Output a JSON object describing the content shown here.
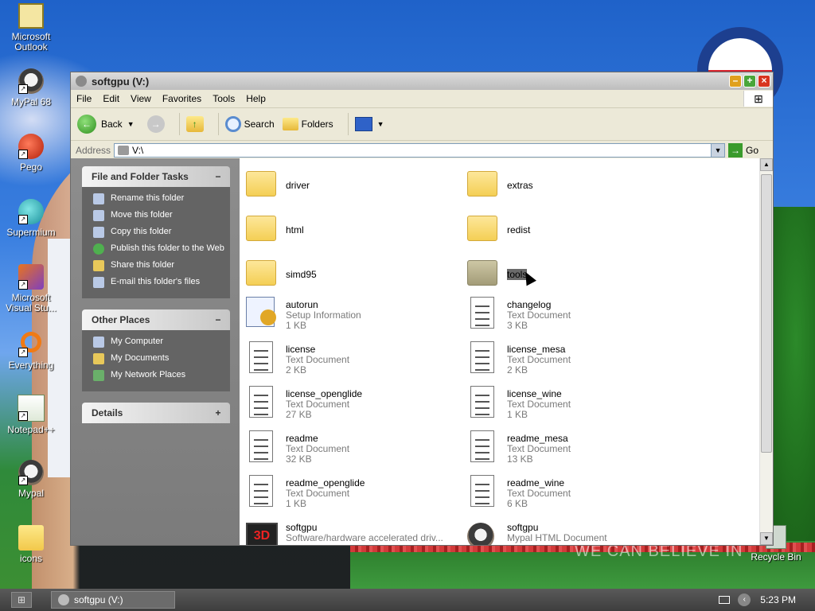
{
  "desktop": {
    "icons": [
      {
        "label": "Microsoft Outlook",
        "icon": "outlook-icon"
      },
      {
        "label": "MyPal 68",
        "icon": "raccoon-icon"
      },
      {
        "label": "Pego",
        "icon": "pego-icon"
      },
      {
        "label": "Supermium",
        "icon": "supermium-icon"
      },
      {
        "label": "Microsoft Visual Stu...",
        "icon": "visual-studio-icon"
      },
      {
        "label": "Everything",
        "icon": "everything-icon"
      },
      {
        "label": "Notepad++",
        "icon": "notepad-icon"
      },
      {
        "label": "Mypal",
        "icon": "raccoon-icon"
      },
      {
        "label": "icons",
        "icon": "folder-icon"
      },
      {
        "label": "Recycle Bin",
        "icon": "recycle-bin-icon"
      }
    ],
    "wallpaper_text": "WE CAN BELIEVE IN"
  },
  "window": {
    "title": "softgpu (V:)",
    "menu": [
      "File",
      "Edit",
      "View",
      "Favorites",
      "Tools",
      "Help"
    ],
    "toolbar": {
      "back": "Back",
      "search": "Search",
      "folders": "Folders"
    },
    "address": {
      "label": "Address",
      "value": "V:\\",
      "go": "Go"
    },
    "tasks_panel": {
      "title": "File and Folder Tasks",
      "items": [
        "Rename this folder",
        "Move this folder",
        "Copy this folder",
        "Publish this folder to the Web",
        "Share this folder",
        "E-mail this folder's files"
      ]
    },
    "places_panel": {
      "title": "Other Places",
      "items": [
        "My Computer",
        "My Documents",
        "My Network Places"
      ]
    },
    "details_panel": {
      "title": "Details"
    },
    "files": [
      {
        "name": "driver",
        "kind": "folder"
      },
      {
        "name": "extras",
        "kind": "folder"
      },
      {
        "name": "html",
        "kind": "folder"
      },
      {
        "name": "redist",
        "kind": "folder"
      },
      {
        "name": "simd95",
        "kind": "folder"
      },
      {
        "name": "tools",
        "kind": "folder",
        "selected": true
      },
      {
        "name": "autorun",
        "type": "Setup Information",
        "size": "1 KB",
        "kind": "setup"
      },
      {
        "name": "changelog",
        "type": "Text Document",
        "size": "3 KB",
        "kind": "text"
      },
      {
        "name": "license",
        "type": "Text Document",
        "size": "2 KB",
        "kind": "text"
      },
      {
        "name": "license_mesa",
        "type": "Text Document",
        "size": "2 KB",
        "kind": "text"
      },
      {
        "name": "license_openglide",
        "type": "Text Document",
        "size": "27 KB",
        "kind": "text"
      },
      {
        "name": "license_wine",
        "type": "Text Document",
        "size": "1 KB",
        "kind": "text"
      },
      {
        "name": "readme",
        "type": "Text Document",
        "size": "32 KB",
        "kind": "text"
      },
      {
        "name": "readme_mesa",
        "type": "Text Document",
        "size": "13 KB",
        "kind": "text"
      },
      {
        "name": "readme_openglide",
        "type": "Text Document",
        "size": "1 KB",
        "kind": "text"
      },
      {
        "name": "readme_wine",
        "type": "Text Document",
        "size": "6 KB",
        "kind": "text"
      },
      {
        "name": "softgpu",
        "type": "Software/hardware accelerated driv...",
        "size": "",
        "kind": "3d"
      },
      {
        "name": "softgpu",
        "type": "Mypal HTML Document",
        "size": "",
        "kind": "html"
      }
    ]
  },
  "taskbar": {
    "button": "softgpu (V:)",
    "clock": "5:23 PM"
  }
}
